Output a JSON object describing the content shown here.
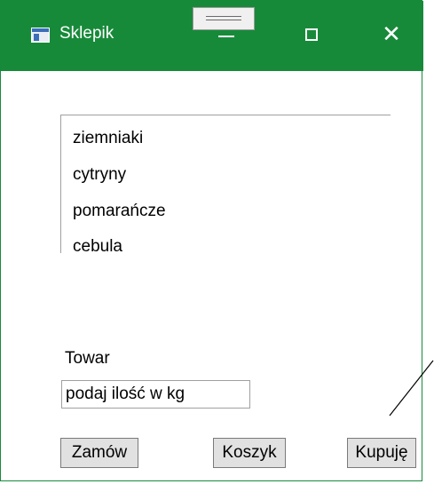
{
  "window": {
    "title": "Sklepik",
    "close_glyph": "✕"
  },
  "titlebar_buttons": {
    "minimize": "minimize-icon",
    "maximize": "maximize-icon",
    "close": "close-icon"
  },
  "list": {
    "items": [
      "ziemniaki",
      "cytryny",
      "pomarańcze",
      "cebula"
    ]
  },
  "form": {
    "label": "Towar",
    "quantity_value": "podaj ilość w kg"
  },
  "buttons": {
    "order": "Zamów",
    "cart": "Koszyk",
    "buy": "Kupuję"
  },
  "colors": {
    "titlebar": "#178a3a",
    "button_bg": "#e1e1e1"
  }
}
